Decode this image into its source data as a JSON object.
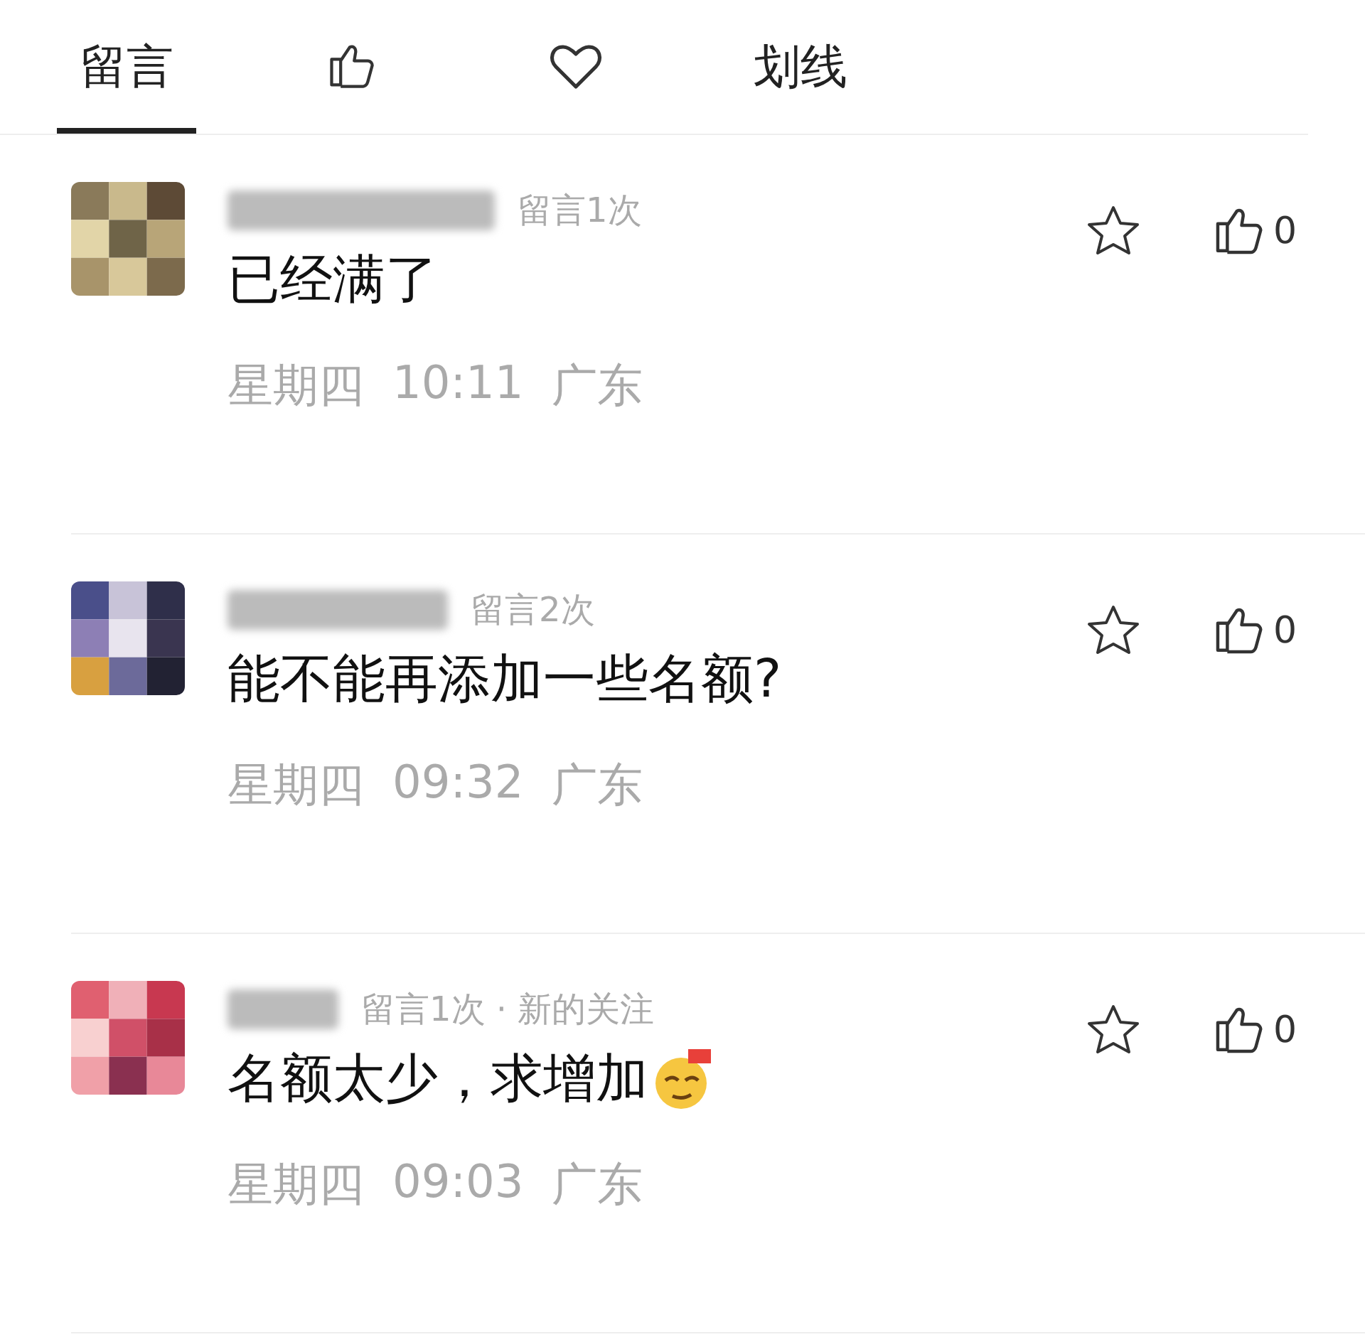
{
  "tabs": [
    {
      "kind": "text",
      "label": "留言",
      "selected": true
    },
    {
      "kind": "like",
      "selected": false
    },
    {
      "kind": "heart",
      "selected": false
    },
    {
      "kind": "text",
      "label": "划线",
      "selected": false
    }
  ],
  "comments": [
    {
      "meta": "留言1次",
      "text": "已经满了",
      "emoji": false,
      "day": "星期四",
      "time": "10:11",
      "location": "广东",
      "starred": false,
      "likes": "0"
    },
    {
      "meta": "留言2次",
      "text": "能不能再添加一些名额?",
      "emoji": false,
      "day": "星期四",
      "time": "09:32",
      "location": "广东",
      "starred": false,
      "likes": "0"
    },
    {
      "meta": "留言1次 · 新的关注",
      "text": "名额太少，求增加",
      "emoji": true,
      "day": "星期四",
      "time": "09:03",
      "location": "广东",
      "starred": false,
      "likes": "0"
    }
  ]
}
